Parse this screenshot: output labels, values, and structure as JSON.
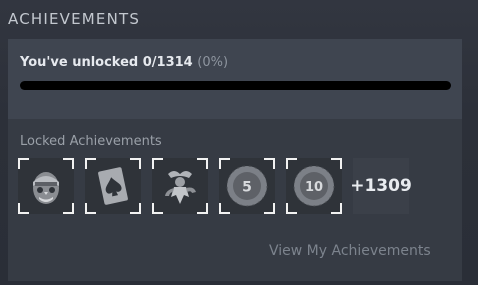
{
  "section": {
    "title": "ACHIEVEMENTS"
  },
  "progress": {
    "text": "You've unlocked 0/1314",
    "percent_text": "(0%)",
    "fraction": 0
  },
  "locked": {
    "label": "Locked Achievements",
    "items": [
      {
        "icon": "clown-mask-icon"
      },
      {
        "icon": "ace-of-spades-card-icon"
      },
      {
        "icon": "jester-figure-icon"
      },
      {
        "icon": "ring-5-icon",
        "text": "5"
      },
      {
        "icon": "ring-10-icon",
        "text": "10"
      }
    ],
    "more_count": "+1309"
  },
  "link": {
    "label": "View My Achievements"
  }
}
